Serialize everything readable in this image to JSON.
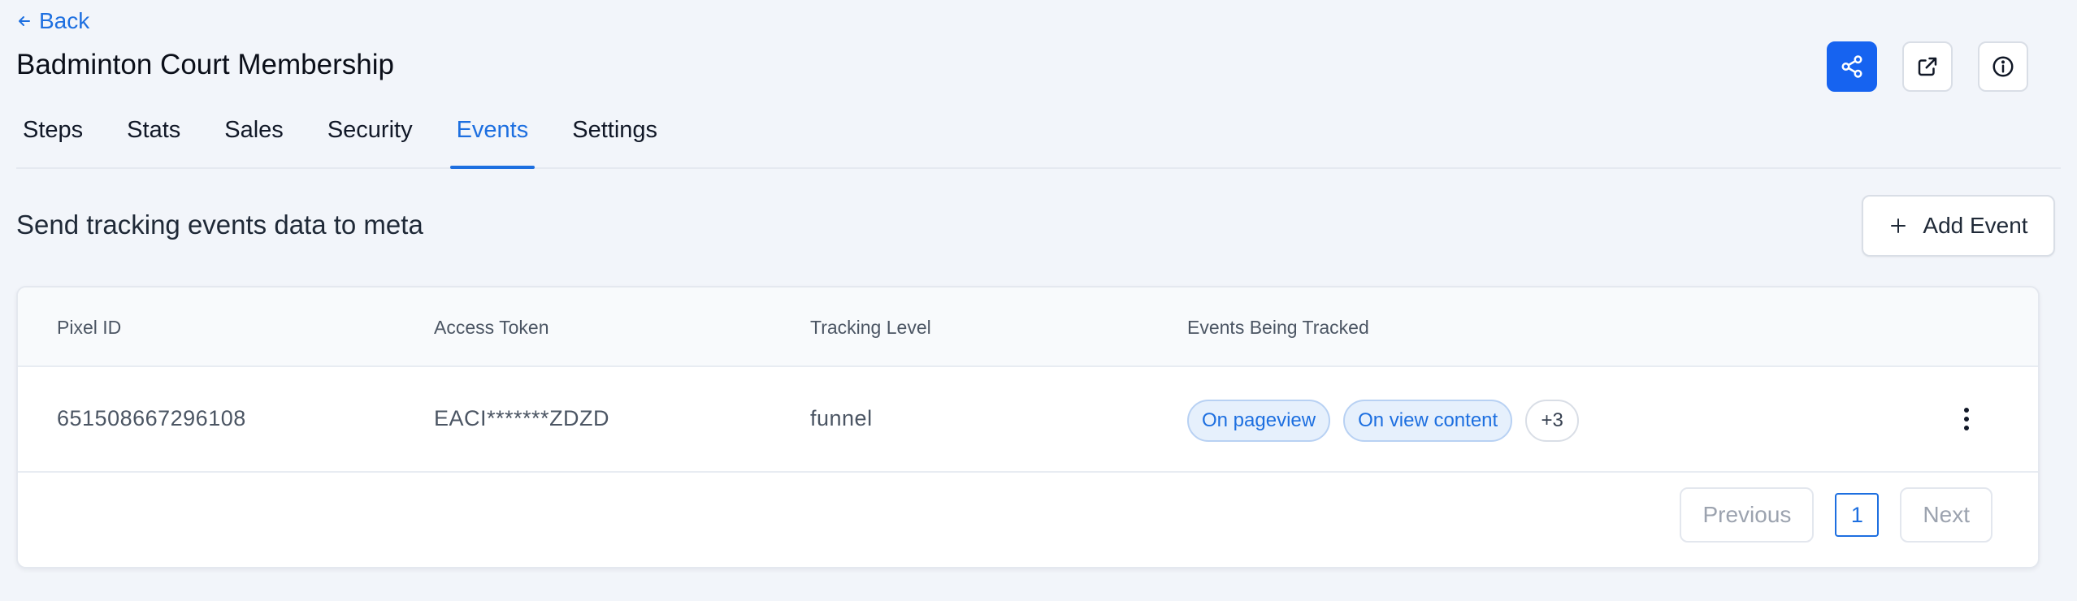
{
  "nav": {
    "back_label": "Back"
  },
  "page": {
    "title": "Badminton Court Membership"
  },
  "header_actions": [
    {
      "name": "share",
      "icon": "share-icon"
    },
    {
      "name": "open-external",
      "icon": "external-link-icon"
    },
    {
      "name": "info",
      "icon": "info-icon"
    }
  ],
  "tabs": [
    {
      "label": "Steps",
      "active": false
    },
    {
      "label": "Stats",
      "active": false
    },
    {
      "label": "Sales",
      "active": false
    },
    {
      "label": "Security",
      "active": false
    },
    {
      "label": "Events",
      "active": true
    },
    {
      "label": "Settings",
      "active": false
    }
  ],
  "section": {
    "title": "Send tracking events data to meta",
    "add_button_label": "Add Event"
  },
  "table": {
    "columns": [
      "Pixel ID",
      "Access Token",
      "Tracking Level",
      "Events Being Tracked"
    ],
    "rows": [
      {
        "pixel_id": "651508667296108",
        "access_token": "EACI*******ZDZD",
        "tracking_level": "funnel",
        "events": [
          "On pageview",
          "On view content"
        ],
        "more_count": "+3"
      }
    ]
  },
  "pagination": {
    "previous_label": "Previous",
    "current_page": "1",
    "next_label": "Next"
  },
  "colors": {
    "accent": "#1d6fe0",
    "primary_button": "#1663f0",
    "background": "#f2f5fa"
  }
}
